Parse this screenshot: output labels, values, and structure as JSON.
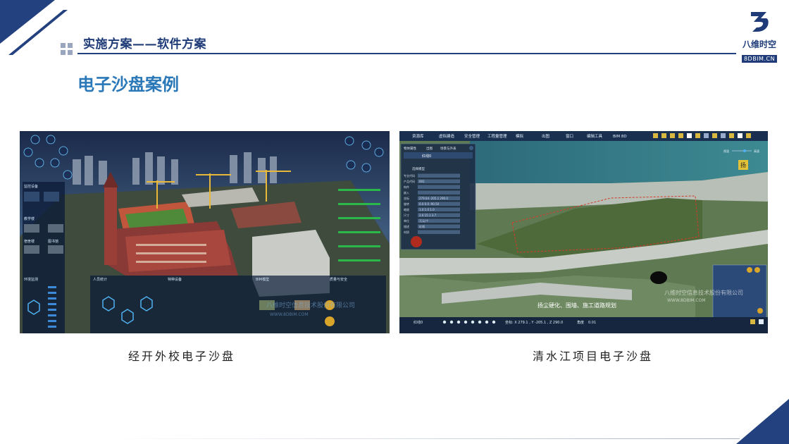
{
  "header": {
    "title": "实施方案——软件方案"
  },
  "logo": {
    "name": "八维时空",
    "badge": "8DBIM.CN"
  },
  "section_title": "电子沙盘案例",
  "screenshots": {
    "left": {
      "caption": "经开外校电子沙盘",
      "panels": {
        "monitor": "监控设备",
        "teaching": "教学楼",
        "dorm": "宿舍楼",
        "library": "图书馆",
        "env": "环境监测",
        "people": "人员统计",
        "equipment": "特种设备",
        "bim": "BIM模型",
        "quality": "质量与安全"
      },
      "watermark": "八维时空信息技术股份有限公司",
      "watermark_url": "WWW.8DBIM.COM"
    },
    "right": {
      "caption": "清水江项目电子沙盘",
      "menu": [
        "资源库",
        "虚拟建造",
        "安全管理",
        "工程量管理",
        "模拟",
        "出图",
        "窗口",
        "编辑工具",
        "BIM 8D"
      ],
      "panel_tabs": [
        "物体属性",
        "出图",
        "场景与外表"
      ],
      "panel_title": "红线0",
      "panel_subtitle": "选择模型",
      "fields": [
        {
          "label": "专业代码",
          "value": ""
        },
        {
          "label": "产品代码",
          "value": "001"
        },
        {
          "label": "构件",
          "value": ""
        },
        {
          "label": "嵌入",
          "value": ""
        },
        {
          "label": "坐标",
          "value": "279.04  -205.1  290.0"
        },
        {
          "label": "旋转",
          "value": "0.0  0.0  -90.50"
        },
        {
          "label": "缩放",
          "value": "1.0  1.0  1.0"
        },
        {
          "label": "尺寸",
          "value": "2.6  15.1  3.7"
        },
        {
          "label": "单位",
          "value": "万元/个"
        },
        {
          "label": "描述",
          "value": "红线"
        },
        {
          "label": "材质",
          "value": ""
        }
      ],
      "overlay_text": "扬尘硬化、围墙、施工道路规划",
      "watermark": "八维时空信息技术股份有限公司",
      "watermark_url": "WWW.8DBIM.COM",
      "status": {
        "layer": "红线0",
        "coords": "坐标: X 279.1 , Y -205.1 , Z 290.0",
        "angle_label": "角度",
        "angle": "0.01"
      },
      "speed_label": "视速",
      "speed_label2": "高速",
      "marker": "扬"
    }
  },
  "colors": {
    "brand": "#1f3c78",
    "accent": "#2a78b8"
  }
}
